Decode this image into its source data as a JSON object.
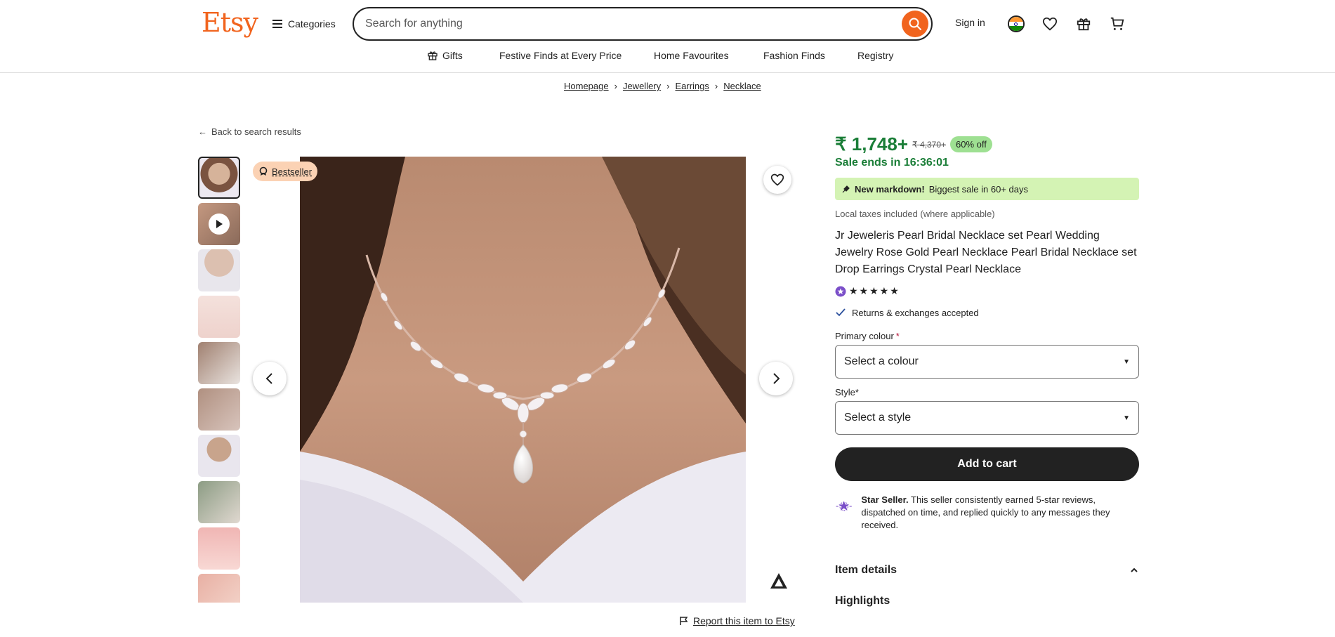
{
  "header": {
    "logo": "Etsy",
    "categories_label": "Categories",
    "search_placeholder": "Search for anything",
    "signin_label": "Sign in"
  },
  "nav": {
    "items": [
      {
        "label": "Gifts",
        "icon": "gift-icon"
      },
      {
        "label": "Festive Finds at Every Price"
      },
      {
        "label": "Home Favourites"
      },
      {
        "label": "Fashion Finds"
      },
      {
        "label": "Registry"
      }
    ]
  },
  "breadcrumb": [
    "Homepage",
    "Jewellery",
    "Earrings",
    "Necklace"
  ],
  "back_label": "Back to search results",
  "gallery": {
    "badge": "Bestseller",
    "report_label": "Report this item to Etsy"
  },
  "product": {
    "price": "₹ 1,748+",
    "old_price": "₹ 4,370+",
    "discount": "60% off",
    "sale_ends": "Sale ends in 16:36:01",
    "markdown_bold": "New markdown!",
    "markdown_text": "Biggest sale in 60+ days",
    "taxes": "Local taxes included (where applicable)",
    "title": "Jr Jeweleris Pearl Bridal Necklace set Pearl Wedding Jewelry Rose Gold Pearl Necklace Pearl Bridal Necklace set Drop Earrings Crystal Pearl Necklace",
    "stars": "★★★★★",
    "returns": "Returns & exchanges accepted",
    "primary_colour_label": "Primary colour",
    "primary_colour_value": "Select a colour",
    "style_label": "Style",
    "style_value": "Select a style",
    "required_mark": "*",
    "add_to_cart": "Add to cart",
    "star_seller_bold": "Star Seller.",
    "star_seller_text": "This seller consistently earned 5-star reviews, dispatched on time, and replied quickly to any messages they received.",
    "item_details": "Item details",
    "highlights": "Highlights"
  },
  "colors": {
    "brand": "#f1641e",
    "price_green": "#1b7e38",
    "discount_bg": "#9ee092",
    "markdown_bg": "#d4f3b4",
    "bestseller_bg": "#fbd2b4",
    "star_seller_purple": "#7b4fc9"
  }
}
